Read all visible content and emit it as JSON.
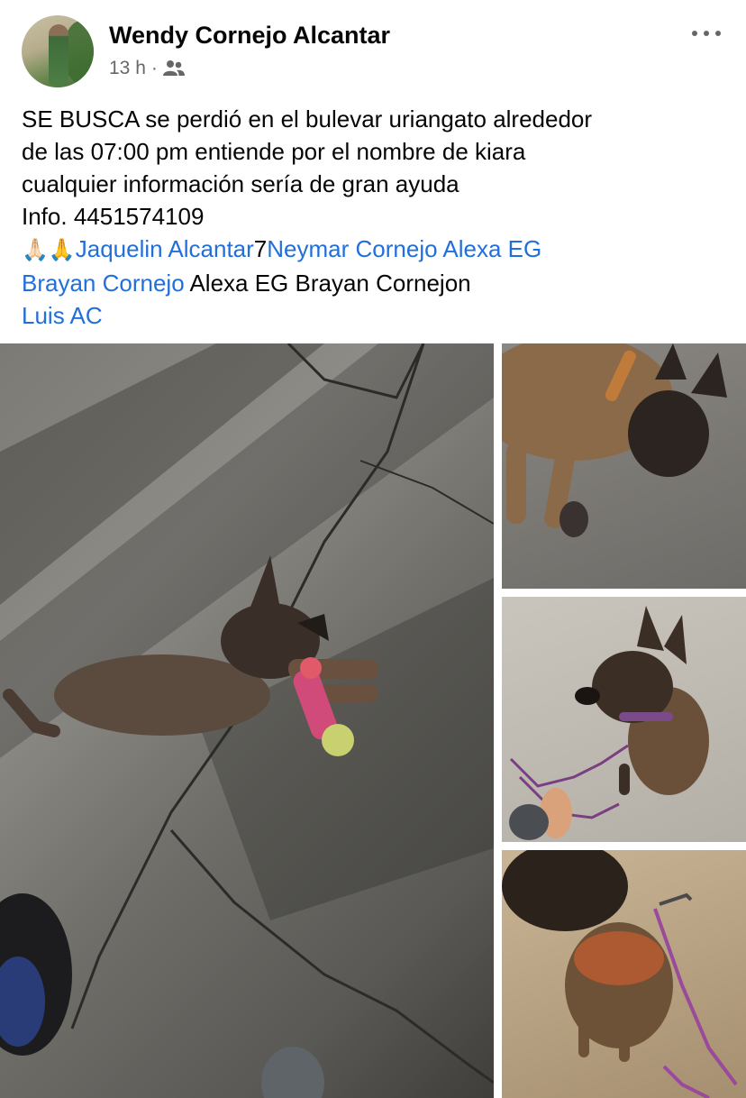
{
  "post": {
    "author": "Wendy Cornejo Alcantar",
    "time": "13 h",
    "separator": "·",
    "audience_icon": "friends-icon",
    "more_icon": "more-options-icon",
    "text_lines": [
      "SE BUSCA se perdió en el bulevar uriangato alrededor",
      "de las 07:00 pm entiende por el nombre de kiara",
      "cualquier información sería de gran ayuda",
      "Info. 4451574109"
    ],
    "emojis": "🙏🏻🙏",
    "tags": {
      "t1": "Jaquelin Alcantar",
      "sep1": "7",
      "t2": "Neymar Cornejo",
      "t3": "Alexa EG",
      "t4": "Brayan Cornejo",
      "plain": "Alexa EG Brayan Cornejon",
      "t5": "Luis AC"
    }
  },
  "colors": {
    "link": "#216fdb",
    "meta": "#65676b",
    "text": "#050505"
  }
}
